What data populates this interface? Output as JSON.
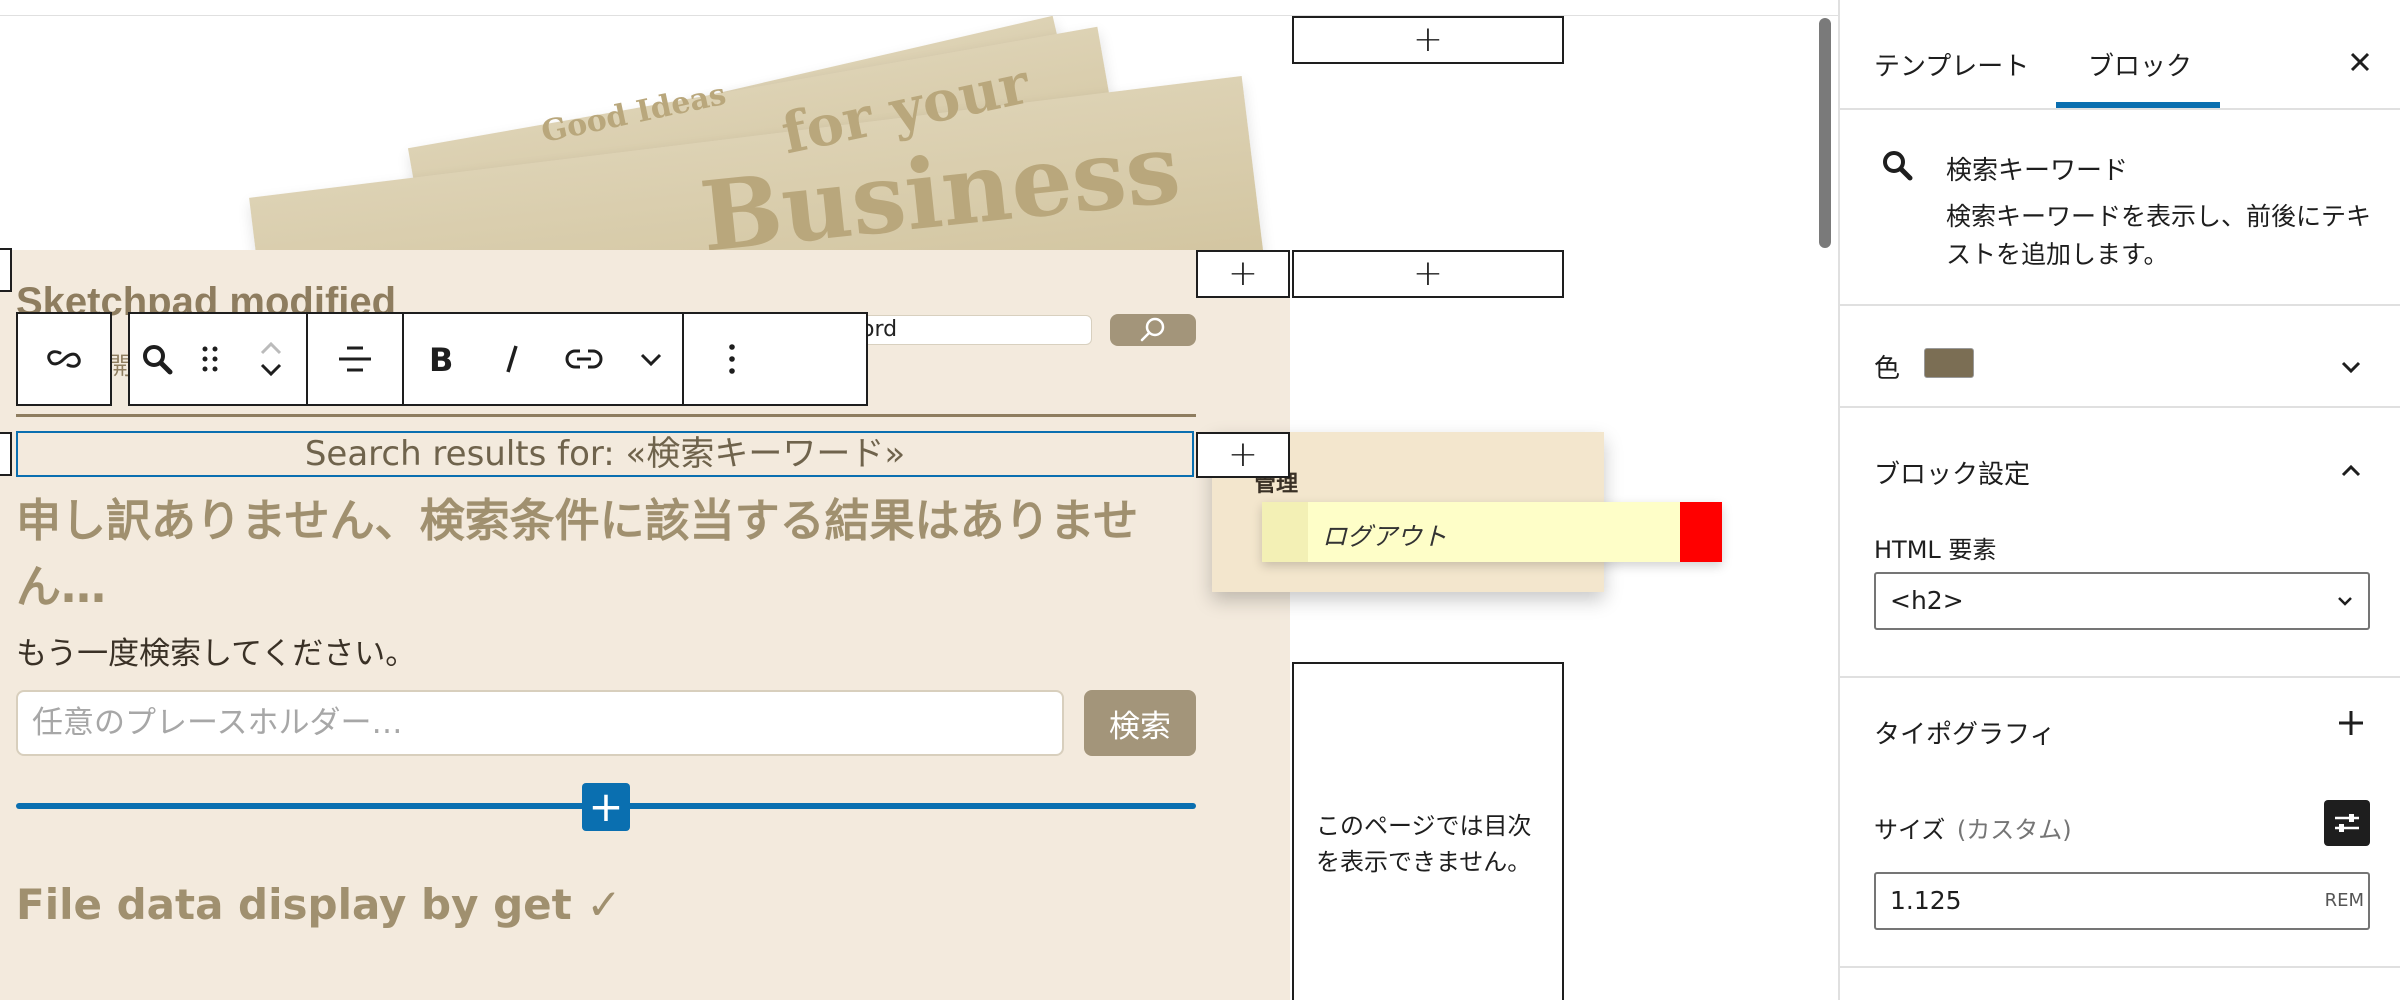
{
  "canvas": {
    "banner": {
      "paper_text_1": "Good Ideas",
      "paper_text_2": "for your",
      "paper_text_3": "Business"
    },
    "site_title": "Sketchpad modified",
    "site_subtitle_fragment": "開",
    "header_search": {
      "value_fragment": "ord"
    },
    "query_title": "Search results for: «検索キーワード»",
    "no_results_heading": "申し訳ありません、検索条件に該当する結果はありません…",
    "try_again_text": "もう一度検索してください。",
    "search": {
      "placeholder": "任意のプレースホルダー…",
      "button_label": "検索"
    },
    "post_title": "File data display by get ✓",
    "login_widget": {
      "label": "管理",
      "logout_text": "ログアウト"
    },
    "toc_message": "このページでは目次を表示できません。",
    "add_block_symbol": "+"
  },
  "toolbar": {
    "buttons": [
      "link-parent",
      "search-block-type",
      "drag",
      "move-up",
      "move-down",
      "align",
      "bold",
      "italic",
      "link",
      "more-formatting",
      "options"
    ]
  },
  "sidebar": {
    "tabs": [
      {
        "label": "テンプレート"
      },
      {
        "label": "ブロック"
      }
    ],
    "active_tab": "ブロック",
    "block": {
      "title": "検索キーワード",
      "description": "検索キーワードを表示し、前後にテキストを追加します。"
    },
    "color_panel": {
      "label": "色",
      "swatch": "#7b6e54"
    },
    "block_settings": {
      "label": "ブロック設定",
      "html_element_label": "HTML 要素",
      "html_element_value": "<h2>"
    },
    "typography": {
      "label": "タイポグラフィ",
      "size_label": "サイズ",
      "size_mode": "(カスタム)",
      "size_value": "1.125",
      "size_unit": "REM"
    }
  },
  "colors": {
    "accent": "#0a6fb0",
    "brand_text": "#8e7d5f",
    "content_bg": "#f3eadd",
    "logout_red": "#ff0000"
  }
}
